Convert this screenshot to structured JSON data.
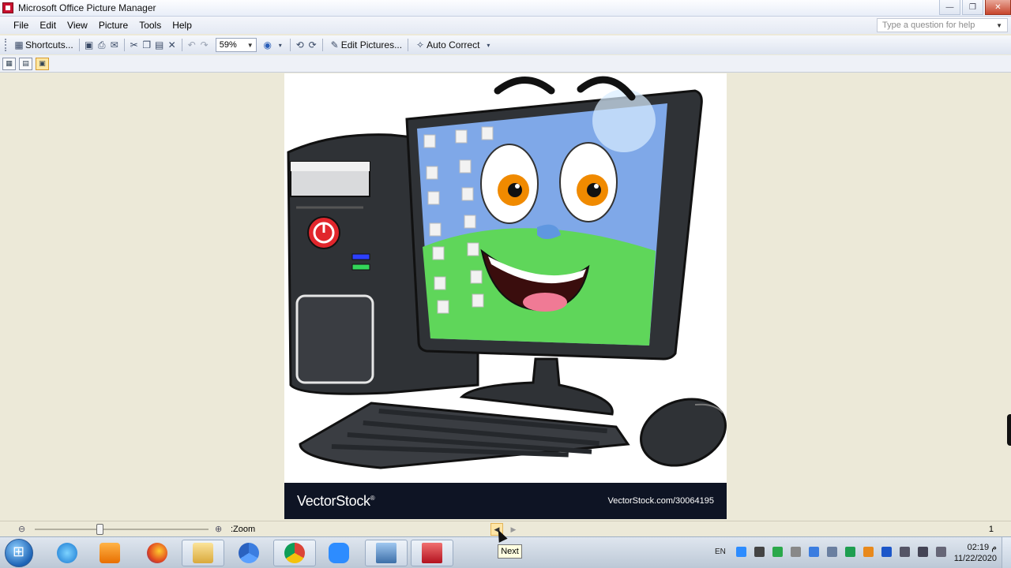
{
  "window": {
    "title": "Microsoft Office Picture Manager",
    "controls": {
      "minimize": "—",
      "restore": "❐",
      "close": "✕"
    }
  },
  "menu": {
    "items": [
      "File",
      "Edit",
      "View",
      "Picture",
      "Tools",
      "Help"
    ],
    "help_placeholder": "Type a question for help"
  },
  "toolbar": {
    "shortcuts_label": "Shortcuts...",
    "zoom_value": "59%",
    "edit_pictures_label": "Edit Pictures...",
    "auto_correct_label": "Auto Correct"
  },
  "picture": {
    "brand": "VectorStock",
    "brand_mark": "®",
    "url": "VectorStock.com/30064195"
  },
  "statusbar": {
    "zoom_label": ":Zoom",
    "page_count": "1",
    "tooltip": "Next"
  },
  "taskbar": {
    "language": "EN",
    "time": "02:19 م",
    "date": "11/22/2020"
  },
  "colors": {
    "screen_sky": "#7fa8e8",
    "screen_grass": "#5fd65a",
    "monitor_body": "#2f3236",
    "power_red": "#e1262c"
  }
}
